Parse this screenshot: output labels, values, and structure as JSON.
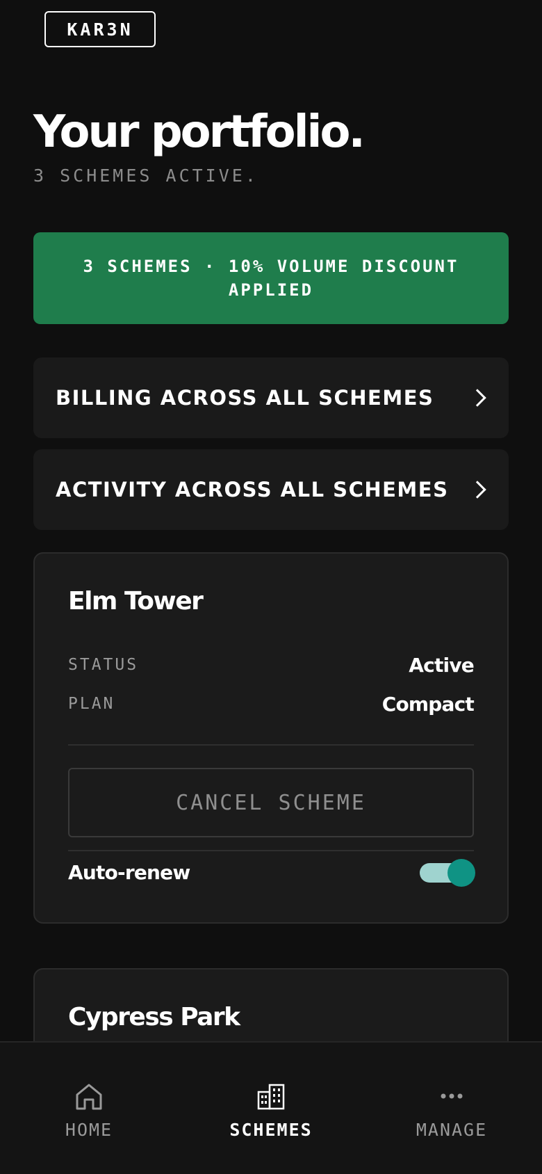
{
  "brand": {
    "logo_text": "KAR3N"
  },
  "header": {
    "title": "Your portfolio.",
    "subtitle": "3 SCHEMES ACTIVE."
  },
  "banner": {
    "text": "3 SCHEMES · 10% VOLUME DISCOUNT APPLIED",
    "color": "#1f7d4c"
  },
  "links": [
    {
      "label": "BILLING ACROSS ALL SCHEMES"
    },
    {
      "label": "ACTIVITY ACROSS ALL SCHEMES"
    }
  ],
  "schemes": [
    {
      "name": "Elm Tower",
      "status_label": "STATUS",
      "status_value": "Active",
      "plan_label": "PLAN",
      "plan_value": "Compact",
      "cancel_label": "CANCEL SCHEME",
      "auto_renew_label": "Auto-renew",
      "auto_renew": true
    },
    {
      "name": "Cypress Park"
    }
  ],
  "bottom_nav": {
    "tabs": [
      {
        "label": "HOME",
        "icon": "home-icon",
        "active": false
      },
      {
        "label": "SCHEMES",
        "icon": "buildings-icon",
        "active": true
      },
      {
        "label": "MANAGE",
        "icon": "more-icon",
        "active": false
      }
    ]
  },
  "colors": {
    "toggle_on": "#0f9384",
    "toggle_track": "#9fd3cf"
  }
}
